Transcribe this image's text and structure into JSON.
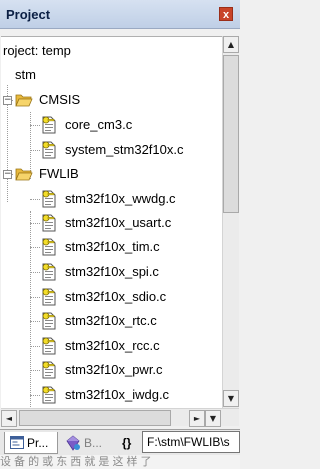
{
  "panel": {
    "title": "Project",
    "close_label": "x"
  },
  "tree": {
    "project_label": "roject: temp",
    "target_label": "stm",
    "groups": [
      {
        "name": "CMSIS",
        "files": [
          "core_cm3.c",
          "system_stm32f10x.c"
        ]
      },
      {
        "name": "FWLIB",
        "files": [
          "stm32f10x_wwdg.c",
          "stm32f10x_usart.c",
          "stm32f10x_tim.c",
          "stm32f10x_spi.c",
          "stm32f10x_sdio.c",
          "stm32f10x_rtc.c",
          "stm32f10x_rcc.c",
          "stm32f10x_pwr.c",
          "stm32f10x_iwdg.c"
        ]
      }
    ]
  },
  "scrollbar": {
    "up": "▲",
    "down": "▼",
    "left": "◄",
    "right": "►"
  },
  "tabs": [
    {
      "label": "Pr...",
      "icon": "project-tab-icon"
    },
    {
      "label": "B...",
      "icon": "books-tab-icon"
    },
    {
      "label": "{}",
      "icon": "functions-tab-icon"
    }
  ],
  "tooltip": "F:\\stm\\FWLIB\\s",
  "bottom_text": "设 备 的 或 东 西 就 是 这 样 了"
}
